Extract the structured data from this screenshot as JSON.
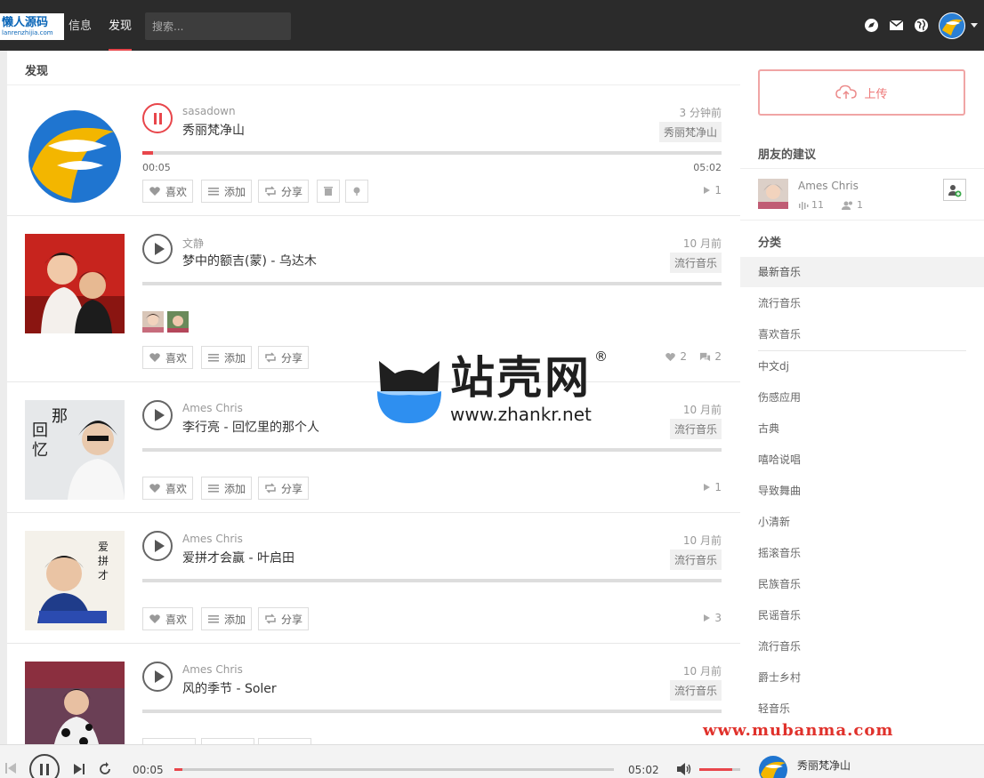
{
  "logo": {
    "main": "懒人源码",
    "sub": "lanrenzhijia.com"
  },
  "nav": {
    "items": [
      {
        "label": "信息"
      },
      {
        "label": "发现"
      }
    ]
  },
  "search": {
    "placeholder": "搜索..."
  },
  "icons": {
    "top": [
      "discover-icon",
      "mail-icon",
      "globe-icon"
    ],
    "accent": "#e8464b"
  },
  "main": {
    "section_title": "发现"
  },
  "feed": [
    {
      "author": "sasadown",
      "title": "秀丽梵净山",
      "time": "3 分钟前",
      "tag": "秀丽梵净山",
      "state": "playing",
      "progress": 0.018,
      "current": "00:05",
      "duration": "05:02",
      "like": "喜欢",
      "add": "添加",
      "share": "分享",
      "plays": "1"
    },
    {
      "author": "文静",
      "title": "梦中的额吉(蒙) - 乌达木",
      "time": "10 月前",
      "tag": "流行音乐",
      "like": "喜欢",
      "add": "添加",
      "share": "分享",
      "likes": "2",
      "comments": "2"
    },
    {
      "author": "Ames Chris",
      "title": "李行亮 - 回忆里的那个人",
      "time": "10 月前",
      "tag": "流行音乐",
      "like": "喜欢",
      "add": "添加",
      "share": "分享",
      "plays": "1"
    },
    {
      "author": "Ames Chris",
      "title": "爱拼才会赢 - 叶启田",
      "time": "10 月前",
      "tag": "流行音乐",
      "like": "喜欢",
      "add": "添加",
      "share": "分享",
      "plays": "3"
    },
    {
      "author": "Ames Chris",
      "title": "风的季节 - Soler",
      "time": "10 月前",
      "tag": "流行音乐"
    }
  ],
  "sidebar": {
    "upload_label": "上传",
    "friends_title": "朋友的建议",
    "friend": {
      "name": "Ames Chris",
      "tracks": "11",
      "followers": "1"
    },
    "categories_title": "分类",
    "categories": [
      "最新音乐",
      "流行音乐",
      "喜欢音乐",
      "中文dj",
      "伤感应用",
      "古典",
      "嘻哈说唱",
      "导致舞曲",
      "小清新",
      "摇滚音乐",
      "民族音乐",
      "民谣音乐",
      "流行音乐",
      "爵士乡村",
      "轻音乐"
    ]
  },
  "watermark": {
    "brand": "站壳网",
    "url": "www.zhankr.net",
    "reg": "®",
    "site2": "www.mubanma.com"
  },
  "player": {
    "current": "00:05",
    "duration": "05:02",
    "title": "秀丽梵净山",
    "progress": 0.018,
    "volume": 0.8
  }
}
